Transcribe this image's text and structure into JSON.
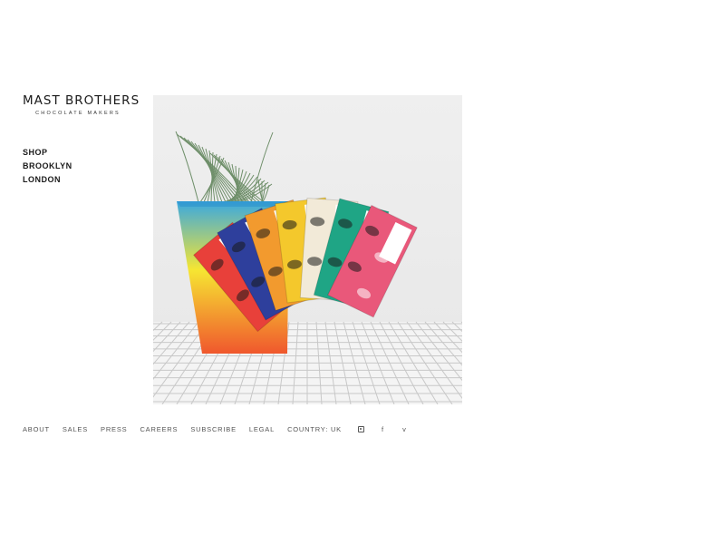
{
  "brand": {
    "name": "MAST BROTHERS",
    "tagline": "CHOCOLATE MAKERS"
  },
  "nav": {
    "items": [
      {
        "label": "SHOP"
      },
      {
        "label": "BROOKLYN"
      },
      {
        "label": "LONDON"
      }
    ]
  },
  "hero": {
    "bars": [
      {
        "color": "#e8403a"
      },
      {
        "color": "#2e3f9c"
      },
      {
        "color": "#f29a2e"
      },
      {
        "color": "#f4c82c"
      },
      {
        "color": "#f2ead8"
      },
      {
        "color": "#1fa585"
      },
      {
        "color": "#e9587a"
      }
    ],
    "planter_gradient": [
      "#3aa8e0",
      "#f6e632",
      "#f0572d"
    ]
  },
  "footer": {
    "links": [
      {
        "label": "ABOUT"
      },
      {
        "label": "SALES"
      },
      {
        "label": "PRESS"
      },
      {
        "label": "CAREERS"
      },
      {
        "label": "SUBSCRIBE"
      },
      {
        "label": "LEGAL"
      },
      {
        "label": "COUNTRY: UK"
      }
    ],
    "social": {
      "facebook": "f",
      "vimeo": "v"
    }
  }
}
